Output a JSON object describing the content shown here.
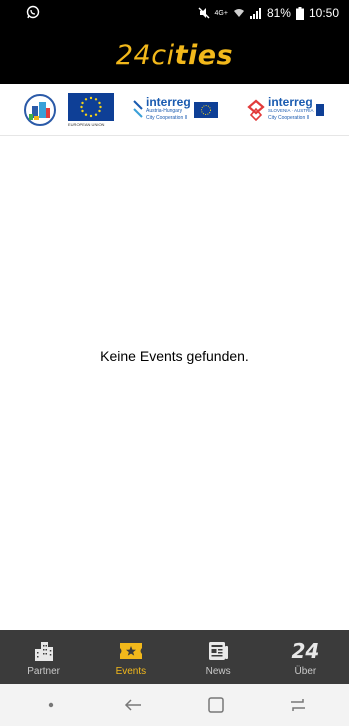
{
  "status": {
    "battery": "81%",
    "time": "10:50",
    "network": "4G+",
    "icons": [
      "whatsapp-icon",
      "mute-icon",
      "wifi-icon",
      "signal-icon",
      "battery-icon"
    ]
  },
  "app": {
    "title_light": "24ci",
    "title_bold": "ties",
    "accent_color": "#f2b81b"
  },
  "logos": {
    "eu_caption": "EUROPEAN UNION",
    "interreg1_name": "interreg",
    "interreg1_sub": "Austria-Hungary",
    "interreg1_coop": "City Cooperation II",
    "interreg2_name": "interreg",
    "interreg2_sub": "SLOVENIA · AUSTRIA",
    "interreg2_coop": "City Cooperation II"
  },
  "main": {
    "empty_message": "Keine Events gefunden."
  },
  "bottom_nav": {
    "items": [
      {
        "label": "Partner",
        "icon": "buildings-icon",
        "active": false
      },
      {
        "label": "Events",
        "icon": "ticket-star-icon",
        "active": true
      },
      {
        "label": "News",
        "icon": "newspaper-icon",
        "active": false
      },
      {
        "label": "Über",
        "icon": "number-24-icon",
        "icon_text": "24",
        "active": false
      }
    ]
  },
  "system_nav": {
    "icons": [
      "dot-icon",
      "back-icon",
      "home-icon",
      "recents-icon"
    ]
  }
}
